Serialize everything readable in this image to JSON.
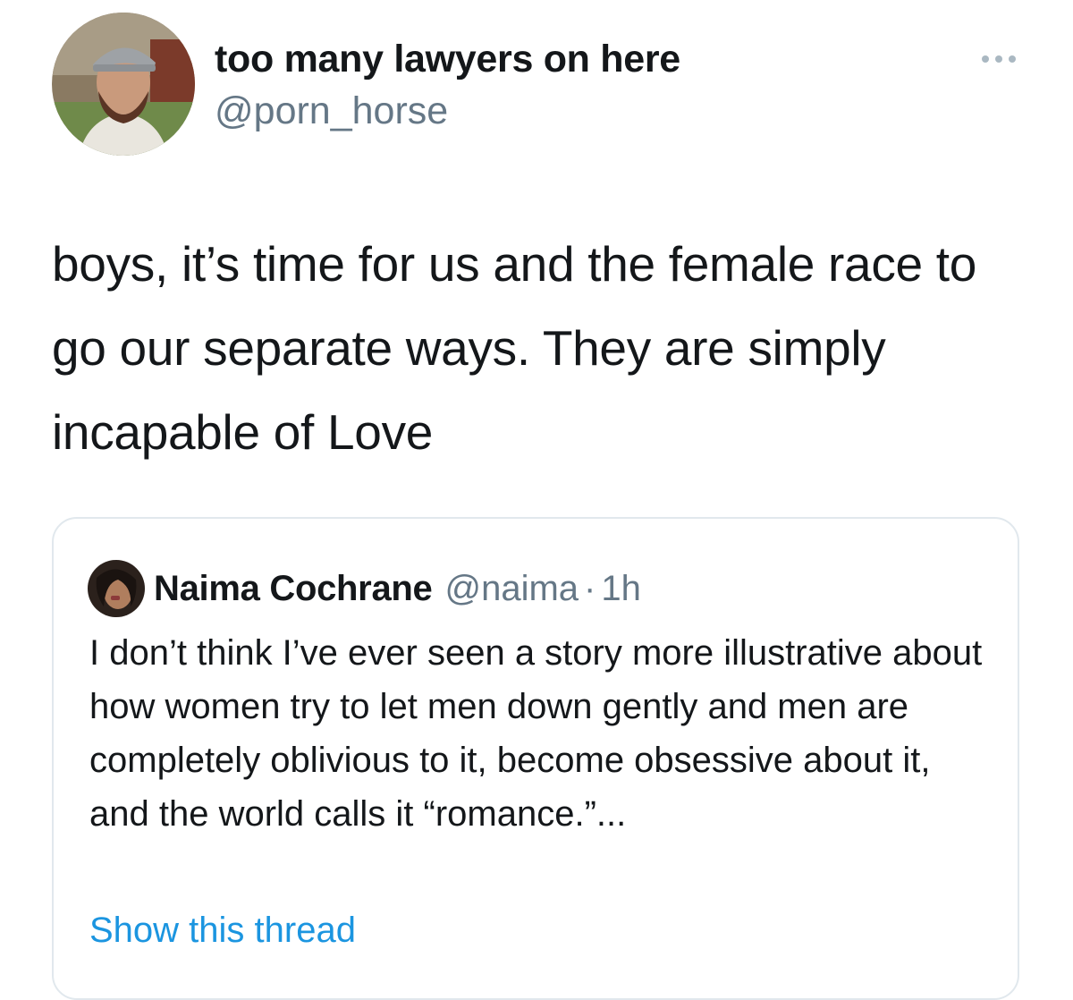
{
  "tweet": {
    "author": {
      "display_name": "too many lawyers on here",
      "handle": "@porn_horse",
      "avatar_icon": "user-avatar-photo"
    },
    "more_icon": "more-horizontal-icon",
    "text": "boys, it’s time for us and the female race to go our separate ways. They are simply incapable of Love"
  },
  "quoted_tweet": {
    "author": {
      "display_name": "Naima Cochrane",
      "handle": "@naima",
      "separator": "·",
      "time": "1h",
      "avatar_icon": "user-avatar-photo"
    },
    "text": "I don’t think I’ve ever seen a story more illustrative about how women try to let men down gently and men are completely oblivious to it, become obsessive about it, and the world calls it “romance.”...",
    "show_thread_label": "Show this thread"
  },
  "colors": {
    "text_primary": "#14171a",
    "text_secondary": "#657786",
    "link": "#1b95e0",
    "border": "#e1e8ed"
  }
}
